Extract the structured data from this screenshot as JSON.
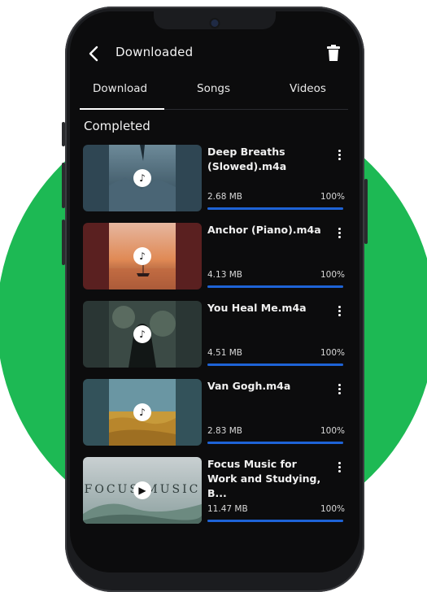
{
  "header": {
    "title": "Downloaded",
    "back_icon": "chevron-left-icon",
    "trash_icon": "trash-icon"
  },
  "tabs": [
    {
      "label": "Download",
      "active": true
    },
    {
      "label": "Songs",
      "active": false
    },
    {
      "label": "Videos",
      "active": false
    }
  ],
  "section_title": "Completed",
  "items": [
    {
      "name": "Deep Breaths\n(Slowed).m4a",
      "size": "2.68 MB",
      "percent": "100%",
      "progress": 1.0,
      "badge": "music-note-icon",
      "art": "icy-blue-album-art"
    },
    {
      "name": "Anchor (Piano).m4a",
      "size": "4.13 MB",
      "percent": "100%",
      "progress": 1.0,
      "badge": "music-note-icon",
      "art": "sunset-boat-album-art"
    },
    {
      "name": "You Heal Me.m4a",
      "size": "4.51 MB",
      "percent": "100%",
      "progress": 1.0,
      "badge": "music-note-icon",
      "art": "forest-figure-album-art"
    },
    {
      "name": "Van Gogh.m4a",
      "size": "2.83 MB",
      "percent": "100%",
      "progress": 1.0,
      "badge": "music-note-icon",
      "art": "wheat-field-album-art"
    },
    {
      "name": "Focus Music for\nWork and Studying, B...",
      "size": "11.47 MB",
      "percent": "100%",
      "progress": 1.0,
      "badge": "play-icon",
      "art": "focus-music-video-thumbnail",
      "thumb_text": "FOCUS MUSIC"
    }
  ],
  "colors": {
    "accent": "#1e63d6",
    "background": "#0c0c0d",
    "brand_circle": "#1db954"
  }
}
